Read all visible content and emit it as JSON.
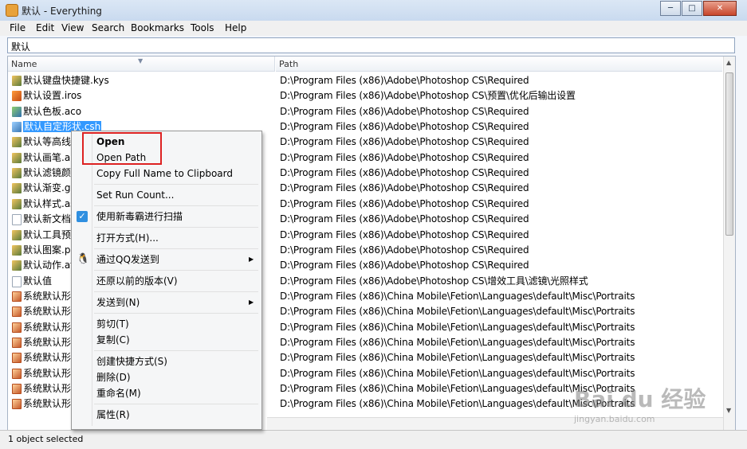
{
  "window": {
    "title": "默认 - Everything"
  },
  "menubar": {
    "items": [
      {
        "label": "File",
        "key": "F"
      },
      {
        "label": "Edit",
        "key": "E"
      },
      {
        "label": "View",
        "key": "V"
      },
      {
        "label": "Search",
        "key": "S"
      },
      {
        "label": "Bookmarks",
        "key": "B"
      },
      {
        "label": "Tools",
        "key": "T"
      },
      {
        "label": "Help",
        "key": "H"
      }
    ]
  },
  "search": {
    "value": "默认"
  },
  "columns": {
    "name": "Name",
    "path": "Path"
  },
  "rows": [
    {
      "name": "默认键盘快捷键.kys",
      "path": "D:\\Program Files (x86)\\Adobe\\Photoshop CS\\Required",
      "icon": "kys-icon"
    },
    {
      "name": "默认设置.iros",
      "path": "D:\\Program Files (x86)\\Adobe\\Photoshop CS\\预置\\优化后输出设置",
      "icon": "iros-icon"
    },
    {
      "name": "默认色板.aco",
      "path": "D:\\Program Files (x86)\\Adobe\\Photoshop CS\\Required",
      "icon": "aco-icon"
    },
    {
      "name": "默认自定形状.csh",
      "path": "D:\\Program Files (x86)\\Adobe\\Photoshop CS\\Required",
      "icon": "csh-icon",
      "selected": true
    },
    {
      "name": "默认等高线.s",
      "path": "D:\\Program Files (x86)\\Adobe\\Photoshop CS\\Required",
      "icon": "kys-icon"
    },
    {
      "name": "默认画笔.ab",
      "path": "D:\\Program Files (x86)\\Adobe\\Photoshop CS\\Required",
      "icon": "kys-icon"
    },
    {
      "name": "默认滤镜颜色",
      "path": "D:\\Program Files (x86)\\Adobe\\Photoshop CS\\Required",
      "icon": "kys-icon"
    },
    {
      "name": "默认渐变.gr",
      "path": "D:\\Program Files (x86)\\Adobe\\Photoshop CS\\Required",
      "icon": "kys-icon"
    },
    {
      "name": "默认样式.as",
      "path": "D:\\Program Files (x86)\\Adobe\\Photoshop CS\\Required",
      "icon": "kys-icon"
    },
    {
      "name": "默认新文档力",
      "path": "D:\\Program Files (x86)\\Adobe\\Photoshop CS\\Required",
      "icon": "doc-icon"
    },
    {
      "name": "默认工具预设",
      "path": "D:\\Program Files (x86)\\Adobe\\Photoshop CS\\Required",
      "icon": "kys-icon"
    },
    {
      "name": "默认图案.pa",
      "path": "D:\\Program Files (x86)\\Adobe\\Photoshop CS\\Required",
      "icon": "kys-icon"
    },
    {
      "name": "默认动作.atn",
      "path": "D:\\Program Files (x86)\\Adobe\\Photoshop CS\\Required",
      "icon": "kys-icon"
    },
    {
      "name": "默认值",
      "path": "D:\\Program Files (x86)\\Adobe\\Photoshop CS\\增效工具\\滤镜\\光照样式",
      "icon": "doc-icon"
    },
    {
      "name": "系统默认形",
      "path": "D:\\Program Files (x86)\\China Mobile\\Fetion\\Languages\\default\\Misc\\Portraits",
      "icon": "fetion-icon"
    },
    {
      "name": "系统默认形",
      "path": "D:\\Program Files (x86)\\China Mobile\\Fetion\\Languages\\default\\Misc\\Portraits",
      "icon": "fetion-icon"
    },
    {
      "name": "系统默认形",
      "path": "D:\\Program Files (x86)\\China Mobile\\Fetion\\Languages\\default\\Misc\\Portraits",
      "icon": "fetion-icon"
    },
    {
      "name": "系统默认形",
      "path": "D:\\Program Files (x86)\\China Mobile\\Fetion\\Languages\\default\\Misc\\Portraits",
      "icon": "fetion-icon"
    },
    {
      "name": "系统默认形",
      "path": "D:\\Program Files (x86)\\China Mobile\\Fetion\\Languages\\default\\Misc\\Portraits",
      "icon": "fetion-icon"
    },
    {
      "name": "系统默认形",
      "path": "D:\\Program Files (x86)\\China Mobile\\Fetion\\Languages\\default\\Misc\\Portraits",
      "icon": "fetion-icon"
    },
    {
      "name": "系统默认形",
      "path": "D:\\Program Files (x86)\\China Mobile\\Fetion\\Languages\\default\\Misc\\Portraits",
      "icon": "fetion-icon"
    },
    {
      "name": "系统默认形",
      "path": "D:\\Program Files (x86)\\China Mobile\\Fetion\\Languages\\default\\Misc\\Portraits",
      "icon": "fetion-icon"
    }
  ],
  "context_menu": {
    "items": [
      {
        "label": "Open",
        "bold": true
      },
      {
        "label": "Open Path"
      },
      {
        "label": "Copy Full Name to Clipboard"
      },
      {
        "sep": true
      },
      {
        "label": "Set Run Count..."
      },
      {
        "sep": true
      },
      {
        "label": "使用新毒霸进行扫描",
        "icon": "check-icon"
      },
      {
        "sep": true
      },
      {
        "label": "打开方式(H)..."
      },
      {
        "sep": true
      },
      {
        "label": "通过QQ发送到",
        "icon": "qq-icon",
        "submenu": true
      },
      {
        "sep": true
      },
      {
        "label": "还原以前的版本(V)"
      },
      {
        "sep": true
      },
      {
        "label": "发送到(N)",
        "submenu": true
      },
      {
        "sep": true
      },
      {
        "label": "剪切(T)"
      },
      {
        "label": "复制(C)"
      },
      {
        "sep": true
      },
      {
        "label": "创建快捷方式(S)"
      },
      {
        "label": "删除(D)"
      },
      {
        "label": "重命名(M)"
      },
      {
        "sep": true
      },
      {
        "label": "属性(R)"
      }
    ]
  },
  "status": {
    "text": "1 object selected"
  },
  "watermark": {
    "main": "Bai du 经验",
    "sub": "jingyan.baidu.com"
  },
  "colors": {
    "selection": "#3399ff",
    "highlight_box": "#dd2222"
  }
}
